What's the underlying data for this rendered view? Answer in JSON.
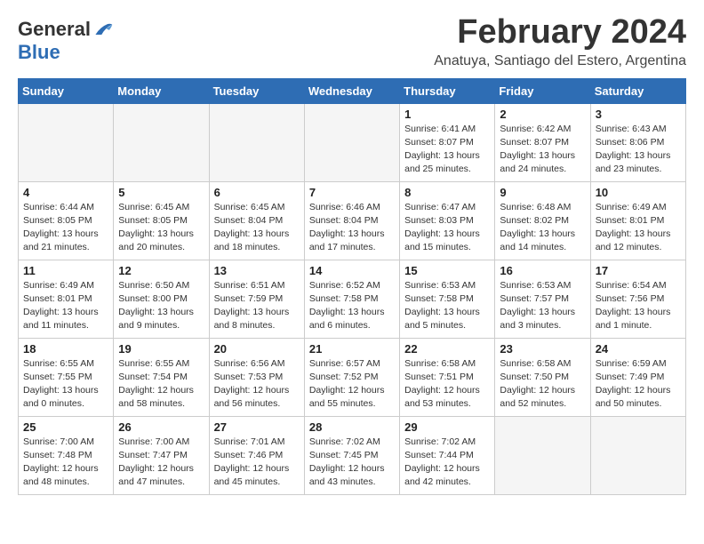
{
  "header": {
    "logo_general": "General",
    "logo_blue": "Blue",
    "month_title": "February 2024",
    "location": "Anatuya, Santiago del Estero, Argentina"
  },
  "weekdays": [
    "Sunday",
    "Monday",
    "Tuesday",
    "Wednesday",
    "Thursday",
    "Friday",
    "Saturday"
  ],
  "weeks": [
    [
      {
        "day": "",
        "info": ""
      },
      {
        "day": "",
        "info": ""
      },
      {
        "day": "",
        "info": ""
      },
      {
        "day": "",
        "info": ""
      },
      {
        "day": "1",
        "info": "Sunrise: 6:41 AM\nSunset: 8:07 PM\nDaylight: 13 hours\nand 25 minutes."
      },
      {
        "day": "2",
        "info": "Sunrise: 6:42 AM\nSunset: 8:07 PM\nDaylight: 13 hours\nand 24 minutes."
      },
      {
        "day": "3",
        "info": "Sunrise: 6:43 AM\nSunset: 8:06 PM\nDaylight: 13 hours\nand 23 minutes."
      }
    ],
    [
      {
        "day": "4",
        "info": "Sunrise: 6:44 AM\nSunset: 8:05 PM\nDaylight: 13 hours\nand 21 minutes."
      },
      {
        "day": "5",
        "info": "Sunrise: 6:45 AM\nSunset: 8:05 PM\nDaylight: 13 hours\nand 20 minutes."
      },
      {
        "day": "6",
        "info": "Sunrise: 6:45 AM\nSunset: 8:04 PM\nDaylight: 13 hours\nand 18 minutes."
      },
      {
        "day": "7",
        "info": "Sunrise: 6:46 AM\nSunset: 8:04 PM\nDaylight: 13 hours\nand 17 minutes."
      },
      {
        "day": "8",
        "info": "Sunrise: 6:47 AM\nSunset: 8:03 PM\nDaylight: 13 hours\nand 15 minutes."
      },
      {
        "day": "9",
        "info": "Sunrise: 6:48 AM\nSunset: 8:02 PM\nDaylight: 13 hours\nand 14 minutes."
      },
      {
        "day": "10",
        "info": "Sunrise: 6:49 AM\nSunset: 8:01 PM\nDaylight: 13 hours\nand 12 minutes."
      }
    ],
    [
      {
        "day": "11",
        "info": "Sunrise: 6:49 AM\nSunset: 8:01 PM\nDaylight: 13 hours\nand 11 minutes."
      },
      {
        "day": "12",
        "info": "Sunrise: 6:50 AM\nSunset: 8:00 PM\nDaylight: 13 hours\nand 9 minutes."
      },
      {
        "day": "13",
        "info": "Sunrise: 6:51 AM\nSunset: 7:59 PM\nDaylight: 13 hours\nand 8 minutes."
      },
      {
        "day": "14",
        "info": "Sunrise: 6:52 AM\nSunset: 7:58 PM\nDaylight: 13 hours\nand 6 minutes."
      },
      {
        "day": "15",
        "info": "Sunrise: 6:53 AM\nSunset: 7:58 PM\nDaylight: 13 hours\nand 5 minutes."
      },
      {
        "day": "16",
        "info": "Sunrise: 6:53 AM\nSunset: 7:57 PM\nDaylight: 13 hours\nand 3 minutes."
      },
      {
        "day": "17",
        "info": "Sunrise: 6:54 AM\nSunset: 7:56 PM\nDaylight: 13 hours\nand 1 minute."
      }
    ],
    [
      {
        "day": "18",
        "info": "Sunrise: 6:55 AM\nSunset: 7:55 PM\nDaylight: 13 hours\nand 0 minutes."
      },
      {
        "day": "19",
        "info": "Sunrise: 6:55 AM\nSunset: 7:54 PM\nDaylight: 12 hours\nand 58 minutes."
      },
      {
        "day": "20",
        "info": "Sunrise: 6:56 AM\nSunset: 7:53 PM\nDaylight: 12 hours\nand 56 minutes."
      },
      {
        "day": "21",
        "info": "Sunrise: 6:57 AM\nSunset: 7:52 PM\nDaylight: 12 hours\nand 55 minutes."
      },
      {
        "day": "22",
        "info": "Sunrise: 6:58 AM\nSunset: 7:51 PM\nDaylight: 12 hours\nand 53 minutes."
      },
      {
        "day": "23",
        "info": "Sunrise: 6:58 AM\nSunset: 7:50 PM\nDaylight: 12 hours\nand 52 minutes."
      },
      {
        "day": "24",
        "info": "Sunrise: 6:59 AM\nSunset: 7:49 PM\nDaylight: 12 hours\nand 50 minutes."
      }
    ],
    [
      {
        "day": "25",
        "info": "Sunrise: 7:00 AM\nSunset: 7:48 PM\nDaylight: 12 hours\nand 48 minutes."
      },
      {
        "day": "26",
        "info": "Sunrise: 7:00 AM\nSunset: 7:47 PM\nDaylight: 12 hours\nand 47 minutes."
      },
      {
        "day": "27",
        "info": "Sunrise: 7:01 AM\nSunset: 7:46 PM\nDaylight: 12 hours\nand 45 minutes."
      },
      {
        "day": "28",
        "info": "Sunrise: 7:02 AM\nSunset: 7:45 PM\nDaylight: 12 hours\nand 43 minutes."
      },
      {
        "day": "29",
        "info": "Sunrise: 7:02 AM\nSunset: 7:44 PM\nDaylight: 12 hours\nand 42 minutes."
      },
      {
        "day": "",
        "info": ""
      },
      {
        "day": "",
        "info": ""
      }
    ]
  ]
}
